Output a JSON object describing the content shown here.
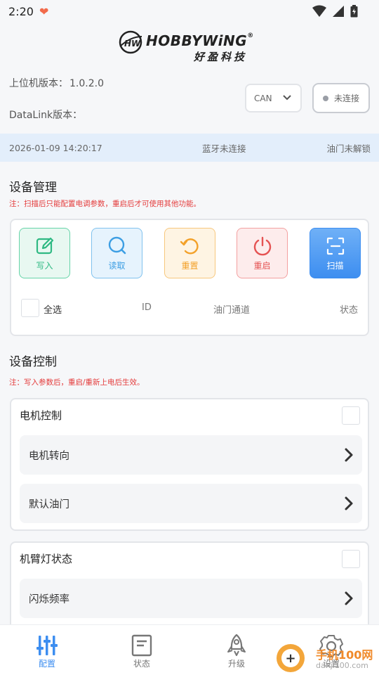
{
  "status_bar": {
    "time": "2:20"
  },
  "brand": {
    "mark": "HW",
    "name": "HOBBYWiNG",
    "registered": "®",
    "tagline": "好盈科技"
  },
  "versions": {
    "pc_label": "上位机版本：",
    "pc_value": "1.0.2.0",
    "datalink_label": "DataLink版本：",
    "datalink_value": ""
  },
  "bus_select": {
    "value": "CAN"
  },
  "connection": {
    "label": "未连接"
  },
  "info_strip": {
    "datetime": "2026-01-09 14:20:17",
    "bluetooth": "蓝牙未连接",
    "throttle": "油门未解锁"
  },
  "device_management": {
    "title": "设备管理",
    "note": "注：扫描后只能配置电调参数，重启后才可使用其他功能。",
    "actions": [
      {
        "label": "写入",
        "icon": "edit-icon",
        "color": "#2fb983"
      },
      {
        "label": "读取",
        "icon": "search-icon",
        "color": "#3c9ee3"
      },
      {
        "label": "重置",
        "icon": "reset-icon",
        "color": "#f3a129"
      },
      {
        "label": "重启",
        "icon": "power-icon",
        "color": "#e55353"
      },
      {
        "label": "扫描",
        "icon": "scan-icon",
        "color": "#3d8ef0"
      }
    ],
    "columns": {
      "select_all": "全选",
      "id": "ID",
      "throttle_channel": "油门通道",
      "status": "状态"
    }
  },
  "device_control": {
    "title": "设备控制",
    "note": "注：写入参数后，重启/重新上电后生效。",
    "groups": [
      {
        "title": "电机控制",
        "rows": [
          "电机转向",
          "默认油门"
        ]
      },
      {
        "title": "机臂灯状态",
        "rows": [
          "闪烁频率"
        ]
      }
    ]
  },
  "tabs": [
    {
      "label": "配置",
      "icon": "sliders-icon",
      "active": true
    },
    {
      "label": "状态",
      "icon": "document-icon",
      "active": false
    },
    {
      "label": "升级",
      "icon": "rocket-icon",
      "active": false
    },
    {
      "label": "设置",
      "icon": "gear-icon",
      "active": false
    }
  ],
  "watermark": {
    "text": "手机100网",
    "url": "danji100.com"
  },
  "colors": {
    "accent": "#3d8ef0",
    "warning": "#e43c3c",
    "strip": "#e3eefb"
  }
}
